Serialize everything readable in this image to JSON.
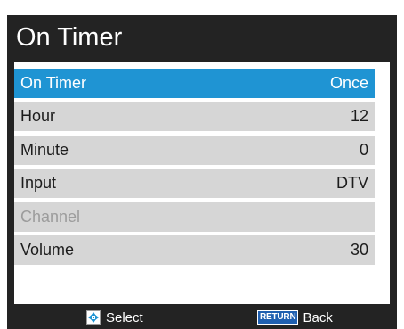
{
  "title": "On Timer",
  "colors": {
    "background": "#232323",
    "selected": "#1f94d3",
    "row": "#d6d6d6",
    "disabled_text": "#9c9c9c"
  },
  "menu": {
    "rows": [
      {
        "label": "On Timer",
        "value": "Once",
        "state": "selected"
      },
      {
        "label": "Hour",
        "value": "12",
        "state": "normal"
      },
      {
        "label": "Minute",
        "value": "0",
        "state": "normal"
      },
      {
        "label": "Input",
        "value": "DTV",
        "state": "normal"
      },
      {
        "label": "Channel",
        "value": "",
        "state": "disabled"
      },
      {
        "label": "Volume",
        "value": "30",
        "state": "normal"
      }
    ]
  },
  "footer": {
    "select_icon": "dpad-icon",
    "select_label": "Select",
    "back_key": "RETURN",
    "back_label": "Back"
  }
}
